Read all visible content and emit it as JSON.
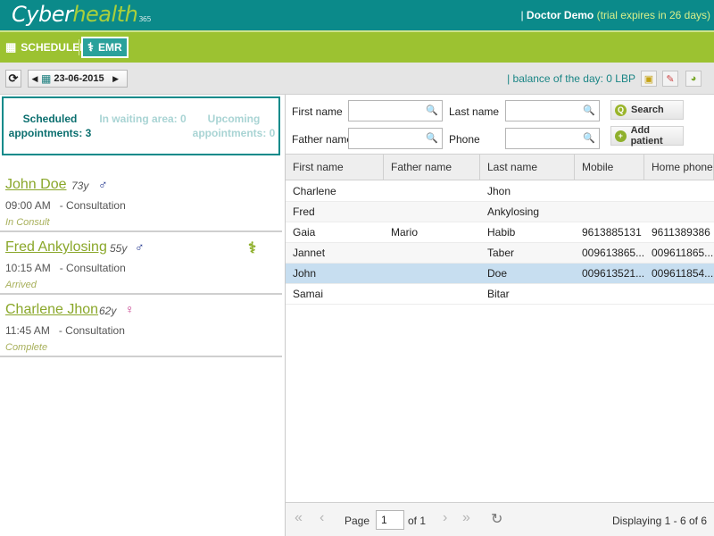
{
  "header": {
    "logo_part1": "Cyber",
    "logo_part2": "health",
    "logo_part3": "365",
    "user_sep": "| ",
    "user_name": "Doctor Demo",
    "trial": "(trial expires in 26 days)"
  },
  "nav": {
    "scheduler_label": "SCHEDULER",
    "scheduler_icon": "calendar-icon",
    "emr_label": "EMR",
    "emr_icon": "stethoscope-icon"
  },
  "toolbar": {
    "date": "23-06-2015",
    "balance": "| balance of the day: 0 LBP"
  },
  "stats": {
    "scheduled": "Scheduled appointments: 3",
    "waiting": "In waiting area: 0",
    "upcoming": "Upcoming appointments: 0"
  },
  "appointments": [
    {
      "name": "John Doe",
      "age": "73y",
      "sex_symbol": "♂",
      "sex": "male",
      "time": "09:00 AM",
      "type": "- Consultation",
      "status": "In Consult"
    },
    {
      "name": "Fred Ankylosing",
      "age": "55y",
      "sex_symbol": "♂",
      "sex": "male",
      "time": "10:15 AM",
      "type": "- Consultation",
      "status": "Arrived",
      "icon": "stethoscope-icon"
    },
    {
      "name": "Charlene Jhon",
      "age": "62y",
      "sex_symbol": "♀",
      "sex": "female",
      "time": "11:45 AM",
      "type": "- Consultation",
      "status": "Complete"
    }
  ],
  "search": {
    "first_name_label": "First name",
    "last_name_label": "Last name",
    "father_name_label": "Father name",
    "phone_label": "Phone",
    "search_button": "Search",
    "add_patient_button": "Add patient"
  },
  "table": {
    "columns": [
      "First name",
      "Father name",
      "Last name",
      "Mobile",
      "Home phone"
    ],
    "rows": [
      [
        "Charlene",
        "",
        "Jhon",
        "",
        ""
      ],
      [
        "Fred",
        "",
        "Ankylosing",
        "",
        ""
      ],
      [
        "Gaia",
        "Mario",
        "Habib",
        "9613885131",
        "9611389386"
      ],
      [
        "Jannet",
        "",
        "Taber",
        "009613865...",
        "009611865..."
      ],
      [
        "John",
        "",
        "Doe",
        "009613521...",
        "009611854..."
      ],
      [
        "Samai",
        "",
        "Bitar",
        "",
        ""
      ]
    ],
    "selected_row": 4
  },
  "pager": {
    "page_label": "Page",
    "page_value": "1",
    "of_label": "of 1",
    "display": "Displaying 1 - 6 of 6"
  }
}
